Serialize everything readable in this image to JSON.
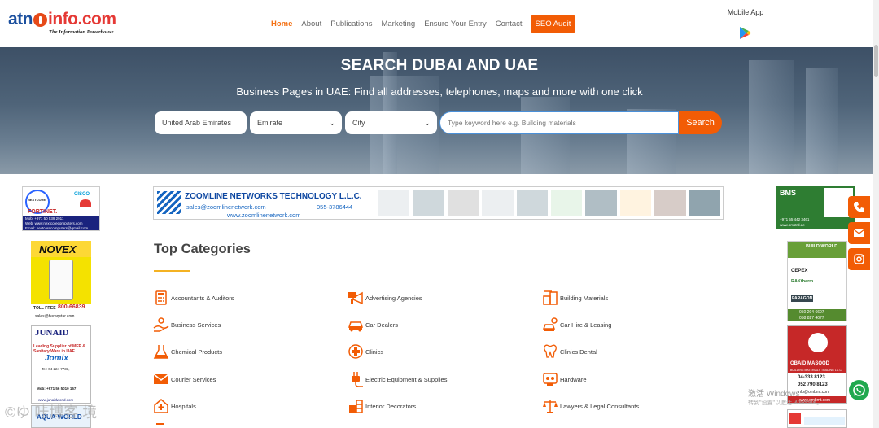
{
  "header": {
    "logo": {
      "left": "atn",
      "right": "info.com",
      "tagline": "The Information Powerhouse"
    },
    "nav": [
      {
        "label": "Home"
      },
      {
        "label": "About"
      },
      {
        "label": "Publications"
      },
      {
        "label": "Marketing"
      },
      {
        "label": "Ensure Your Entry"
      },
      {
        "label": "Contact"
      }
    ],
    "seo_label": "SEO Audit",
    "mobile_app": "Mobile App"
  },
  "hero": {
    "title": "SEARCH DUBAI AND UAE",
    "subtitle": "Business Pages in UAE: Find all addresses, telephones, maps and more with one click",
    "country": "United Arab Emirates",
    "emirate": "Emirate",
    "city": "City",
    "keyword_placeholder": "Type keyword here e.g. Building materials",
    "search_label": "Search"
  },
  "ads": {
    "nextcore": {
      "brand": "NEXTCORE",
      "cisco": "CISCO",
      "fortinet": "FORTINET.",
      "mob": "Mob: +971 50 539 2911",
      "web": "Web: www.nextcorecomputers.com",
      "email": "Email: nextcorecomputers@gmail.com"
    },
    "novex": {
      "brand": "NOVEX",
      "toll": "TOLL FREE",
      "tollnum": "800-66839",
      "email": "sales@buraqstar.com"
    },
    "junaid": {
      "brand": "JUNAID",
      "line1": "Leading Supplier of MEP &",
      "line2": "Sanitary Ware in UAE",
      "jomix": "Jomix",
      "tel": "Tel: 04 224 7733,",
      "mob": "Mob: +971 56 5010 167",
      "web": "www.junaidworld.com"
    },
    "aqua": {
      "brand": "AQUA WORLD"
    },
    "zoom": {
      "name": "ZOOMLINE NETWORKS TECHNOLOGY L.L.C.",
      "email": "sales@zoomlinenetwork.com",
      "phone": "055-3786444",
      "web": "www.zoomlinenetwork.com"
    },
    "bms": {
      "brand": "BMS",
      "phone": "+971 55 442 3461",
      "web": "www.bmstrd.ae"
    },
    "build": {
      "brand": "BUILD WORLD",
      "cepex": "CEPEX",
      "rakherm": "RAKtherm",
      "paragon": "PARAGON",
      "phone1": "050 204 6607",
      "phone2": "058 827 4077"
    },
    "obaid": {
      "brand": "OBAID MASOOD",
      "sub": "BUILDING MATERIALS TRADING L.L.C.",
      "phone1": "04-333 8123",
      "phone2": "052 790 8123",
      "email": "info@ombmt.com",
      "web": "www.ombmt.com"
    }
  },
  "categories": {
    "title": "Top Categories",
    "items": [
      {
        "label": "Accountants & Auditors",
        "icon": "calculator-icon"
      },
      {
        "label": "Advertising Agencies",
        "icon": "megaphone-icon"
      },
      {
        "label": "Building Materials",
        "icon": "building-icon"
      },
      {
        "label": "Business Services",
        "icon": "handshake-icon"
      },
      {
        "label": "Car Dealers",
        "icon": "car-icon"
      },
      {
        "label": "Car Hire & Leasing",
        "icon": "car-key-icon"
      },
      {
        "label": "Chemical Products",
        "icon": "flask-icon"
      },
      {
        "label": "Clinics",
        "icon": "medical-cross-icon"
      },
      {
        "label": "Clinics Dental",
        "icon": "tooth-icon"
      },
      {
        "label": "Courier Services",
        "icon": "envelope-icon"
      },
      {
        "label": "Electric Equipment & Supplies",
        "icon": "plug-icon"
      },
      {
        "label": "Hardware",
        "icon": "hardware-icon"
      },
      {
        "label": "Hospitals",
        "icon": "hospital-icon"
      },
      {
        "label": "Interior Decorators",
        "icon": "interior-icon"
      },
      {
        "label": "Lawyers & Legal Consultants",
        "icon": "scales-icon"
      }
    ]
  },
  "watermark": {
    "line1": "激活 Windows",
    "line2": "转到\"设置\"以激活 Windows。",
    "bottom": "©ゆ 咔博客 境"
  },
  "colors": {
    "accent": "#f25c05",
    "hero": "#4f6479",
    "whatsapp": "#21a84f"
  }
}
